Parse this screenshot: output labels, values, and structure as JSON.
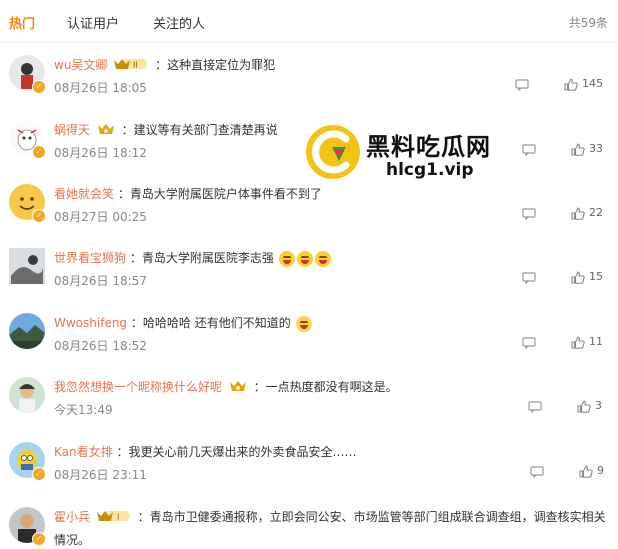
{
  "tabs": {
    "hot": "热门",
    "verified": "认证用户",
    "following": "关注的人"
  },
  "total": "共59条",
  "watermark": {
    "title": "黑料吃瓜网",
    "url": "hlcg1.vip"
  },
  "colors": {
    "accent": "#ff8200",
    "username": "#eb7350",
    "badge": "#f6a623"
  },
  "comments": [
    {
      "user": "wu吴文卿",
      "text": "：这种直接定位为罪犯",
      "time": "08月26日 18:05",
      "likes": "145",
      "crown": "II"
    },
    {
      "user": "蜗得天",
      "text": "：建议等有关部门查清楚再说",
      "time": "08月26日 18:12",
      "likes": "33",
      "crown": ""
    },
    {
      "user": "看她就会笑",
      "text": "：青岛大学附属医院户体事件看不到了",
      "time": "08月27日 00:25",
      "likes": "22",
      "crown": ""
    },
    {
      "user": "世界看宝狮狗",
      "text": "：青岛大学附属医院李志强",
      "time": "08月26日 18:57",
      "likes": "15",
      "crown": ""
    },
    {
      "user": "Wwoshifeng",
      "text": "：哈哈哈哈 还有他们不知道的",
      "time": "08月26日 18:52",
      "likes": "11",
      "crown": ""
    },
    {
      "user": "我忽然想换一个昵称换什么好呢",
      "text": "：一点热度都没有啊这是。",
      "time": "今天13:49",
      "likes": "3",
      "crown": ""
    },
    {
      "user": "Kan看女排",
      "text": "：我更关心前几天爆出来的外卖食品安全……",
      "time": "08月26日 23:11",
      "likes": "9",
      "crown": ""
    },
    {
      "user": "霍小兵",
      "text": "：青岛市卫健委通报称，立即会同公安、市场监管等部门组成联合调查组，调查核实相关",
      "text2": "情况。",
      "time": "",
      "likes": "",
      "crown": "I"
    }
  ]
}
